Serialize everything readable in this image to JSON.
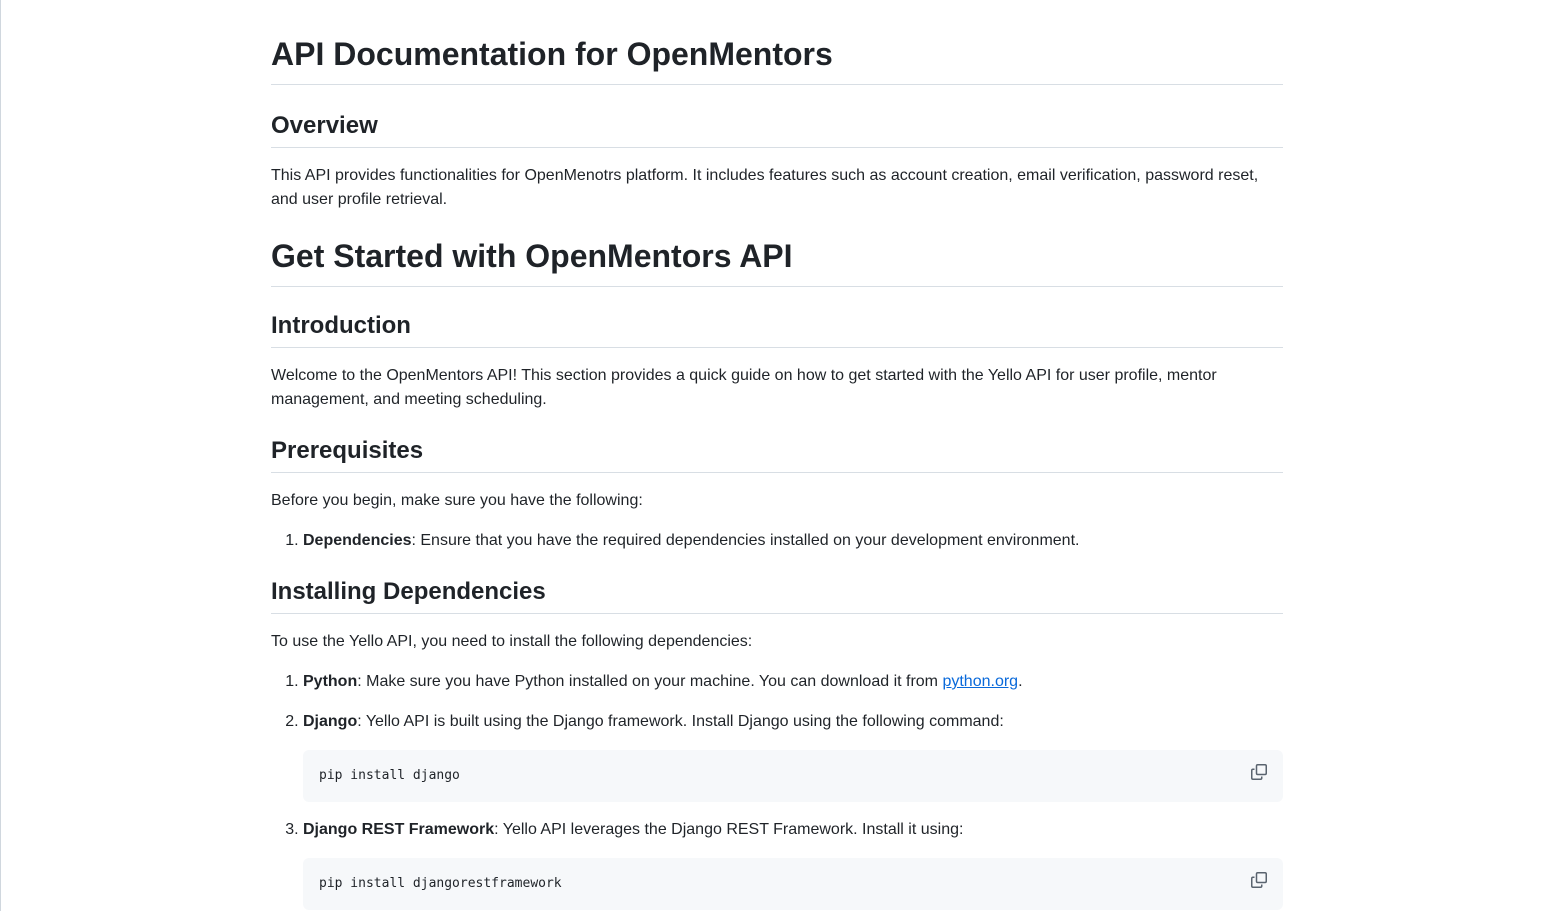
{
  "doc": {
    "title": "API Documentation for OpenMentors",
    "overview": {
      "heading": "Overview",
      "text": "This API provides functionalities for OpenMenotrs platform. It includes features such as account creation, email verification, password reset, and user profile retrieval."
    },
    "get_started": {
      "title": "Get Started with OpenMentors API"
    },
    "introduction": {
      "heading": "Introduction",
      "text": "Welcome to the OpenMentors API! This section provides a quick guide on how to get started with the Yello API for user profile, mentor management, and meeting scheduling."
    },
    "prerequisites": {
      "heading": "Prerequisites",
      "text": "Before you begin, make sure you have the following:",
      "items": [
        {
          "label": "Dependencies",
          "text": ": Ensure that you have the required dependencies installed on your development environment."
        }
      ]
    },
    "installing": {
      "heading": "Installing Dependencies",
      "text": "To use the Yello API, you need to install the following dependencies:",
      "items": [
        {
          "label": "Python",
          "text": ": Make sure you have Python installed on your machine. You can download it from ",
          "link": "python.org",
          "suffix": "."
        },
        {
          "label": "Django",
          "text": ": Yello API is built using the Django framework. Install Django using the following command:",
          "code": "pip install django"
        },
        {
          "label": "Django REST Framework",
          "text": ": Yello API leverages the Django REST Framework. Install it using:",
          "code": "pip install djangorestframework"
        }
      ]
    }
  },
  "colors": {
    "text": "#1f2328",
    "link": "#0969da",
    "code_bg": "#f6f8fa",
    "border": "#d8dee4",
    "icon": "#59636e"
  },
  "icons": {
    "copy": "copy-icon"
  }
}
